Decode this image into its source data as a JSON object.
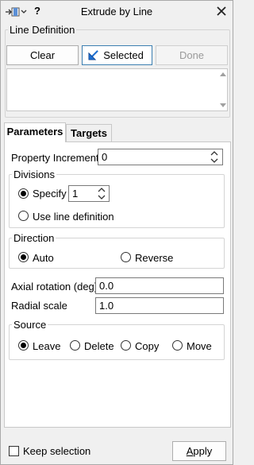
{
  "window": {
    "title": "Extrude by Line",
    "help_label": "?"
  },
  "line_definition": {
    "label": "Line Definition",
    "clear_label": "Clear",
    "selected_label": "Selected",
    "done_label": "Done"
  },
  "tabs": [
    {
      "label": "Parameters",
      "active": true
    },
    {
      "label": "Targets",
      "active": false
    }
  ],
  "parameters": {
    "property_increment": {
      "label": "Property Increment",
      "value": "0"
    },
    "divisions": {
      "label": "Divisions",
      "specify_label": "Specify",
      "specify_value": "1",
      "use_line_label": "Use line definition",
      "selected": "specify"
    },
    "direction": {
      "label": "Direction",
      "auto_label": "Auto",
      "reverse_label": "Reverse",
      "selected": "auto"
    },
    "axial_rotation": {
      "label": "Axial rotation (deg)",
      "value": "0.0"
    },
    "radial_scale": {
      "label": "Radial scale",
      "value": "1.0"
    },
    "source": {
      "label": "Source",
      "leave_label": "Leave",
      "delete_label": "Delete",
      "copy_label": "Copy",
      "move_label": "Move",
      "selected": "leave"
    }
  },
  "footer": {
    "keep_selection_label": "Keep selection",
    "apply_label_prefix": "",
    "apply_label_underlined": "A",
    "apply_label_rest": "pply"
  },
  "icons": {
    "pin": "pin-dropdown-icon",
    "close": "close-icon",
    "selected": "select-arrow-icon"
  },
  "colors": {
    "accent_border": "#3c7fb1",
    "select_arrow": "#1e6fd0"
  }
}
